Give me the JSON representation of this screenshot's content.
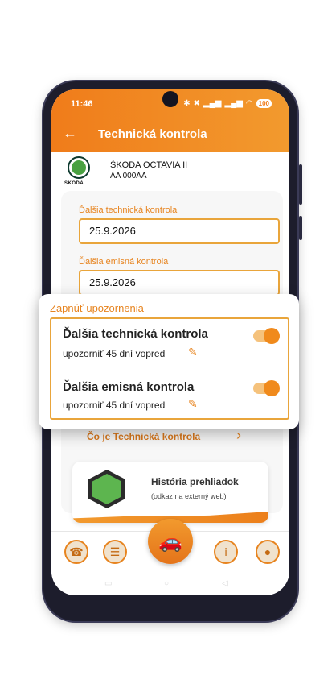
{
  "status": {
    "time": "11:46",
    "icons": [
      "bluetooth-icon",
      "mute-icon",
      "signal-icon",
      "signal-icon",
      "wifi-icon"
    ],
    "battery": "100"
  },
  "header": {
    "title": "Technická kontrola"
  },
  "vehicle": {
    "brand": "ŠKODA",
    "name": "ŠKODA OCTAVIA II",
    "plate": "AA 000AA"
  },
  "form": {
    "tech_label": "Ďalšia technická kontrola",
    "tech_value": "25.9.2026",
    "emis_label": "Ďalšia emisná kontrola",
    "emis_value": "25.9.2026"
  },
  "reminders": {
    "title": "Zapnúť upozornenia",
    "items": [
      {
        "title": "Ďalšia technická kontrola",
        "subtitle": "upozorniť 45 dní vopred",
        "enabled": true
      },
      {
        "title": "Ďalšia emisná kontrola",
        "subtitle": "upozorniť 45 dní vopred",
        "enabled": true
      }
    ]
  },
  "info_link": "Čo je Technická kontrola",
  "history": {
    "title": "História prehliadok",
    "subtitle": "(odkaz na externý web)"
  },
  "tabs": [
    "phone-icon",
    "checklist-icon",
    "car-icon",
    "info-icon",
    "profile-icon"
  ],
  "colors": {
    "accent": "#f07c1a",
    "accent_light": "#e9a53b"
  }
}
